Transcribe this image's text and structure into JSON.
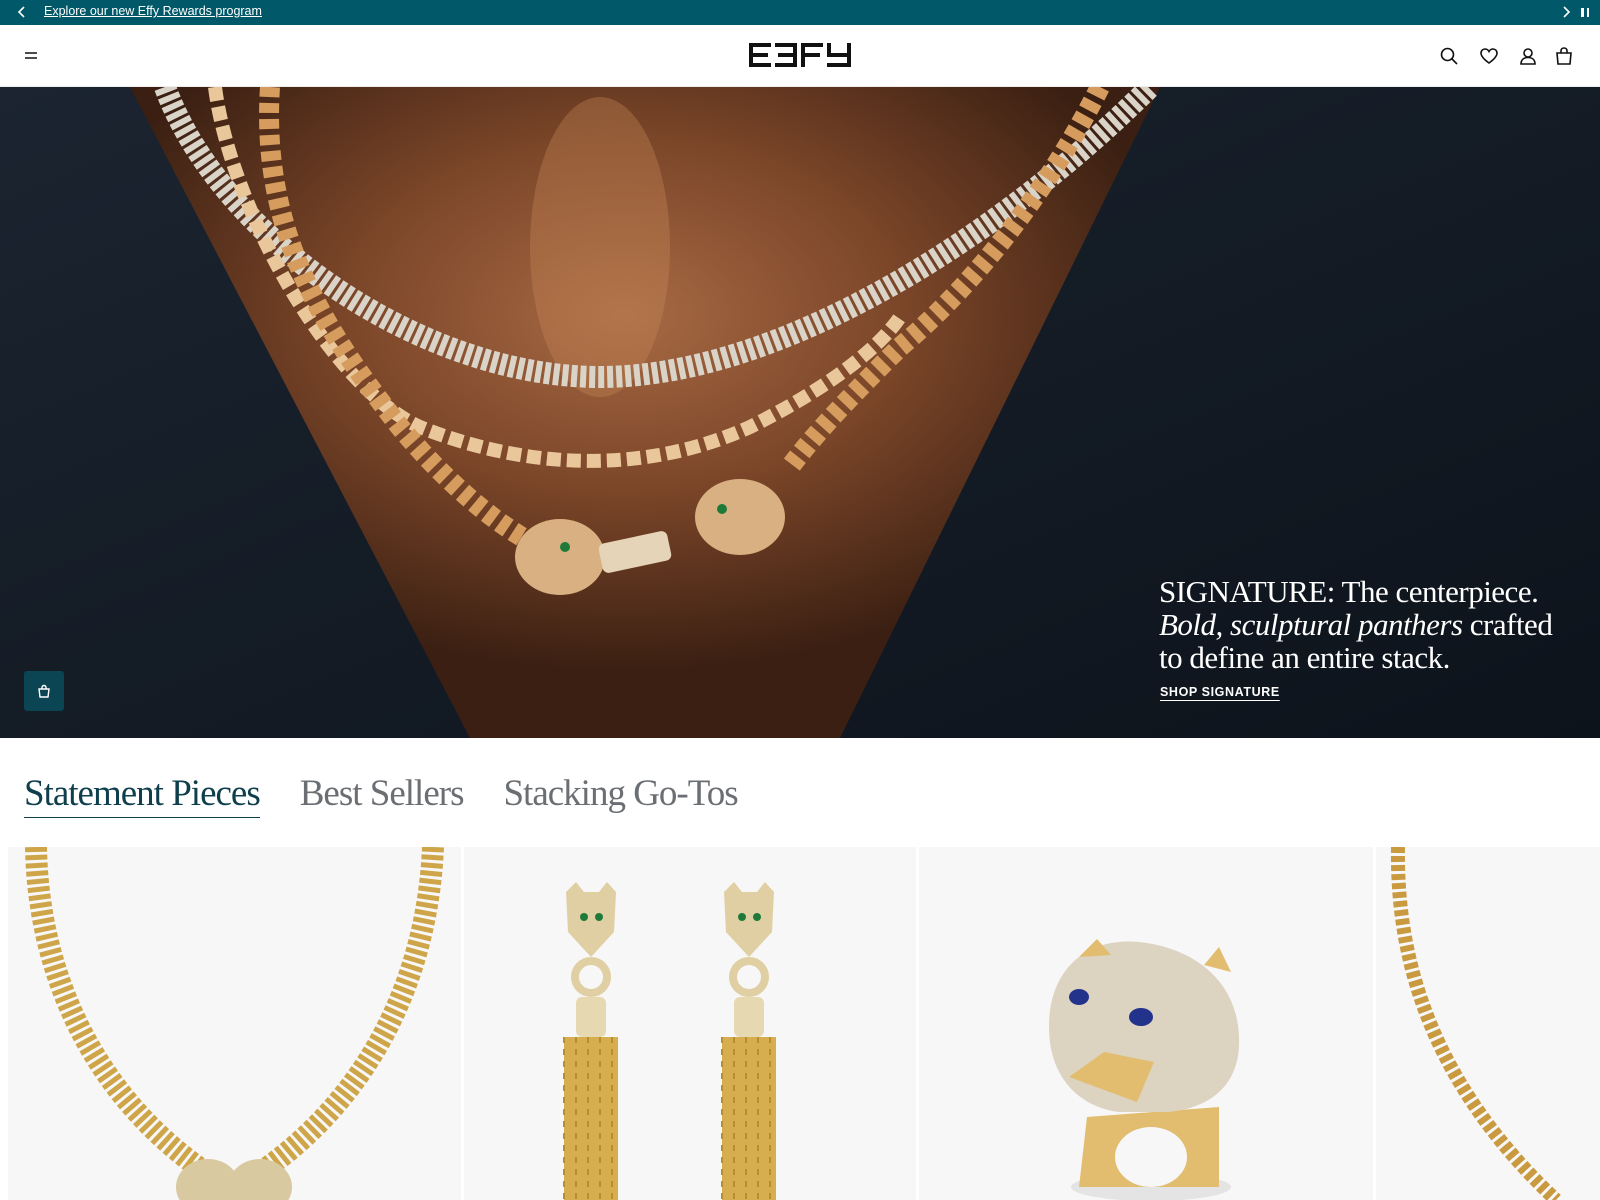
{
  "announcement": {
    "text": "Explore our new Effy Rewards program",
    "prev_icon": "chevron-left-icon",
    "next_icon": "chevron-right-icon",
    "pause_icon": "pause-icon"
  },
  "header": {
    "logo_text": "EFFY",
    "icons": [
      "menu-icon",
      "search-icon",
      "heart-icon",
      "account-icon",
      "bag-icon"
    ]
  },
  "hero": {
    "headline_lead": "SIGNATURE: The centerpiece.",
    "headline_italic": "Bold, sculptural panthers",
    "headline_rest_1": " crafted",
    "headline_rest_2": "to define an entire stack.",
    "cta_label": "SHOP SIGNATURE",
    "shop_icon": "shopping-bag-icon"
  },
  "tabs": [
    {
      "label": "Statement Pieces",
      "active": true
    },
    {
      "label": "Best Sellers",
      "active": false
    },
    {
      "label": "Stacking Go-Tos",
      "active": false
    }
  ],
  "colors": {
    "brand_teal": "#005868",
    "dark_teal": "#0b4452",
    "gold": "#d8b25c"
  }
}
